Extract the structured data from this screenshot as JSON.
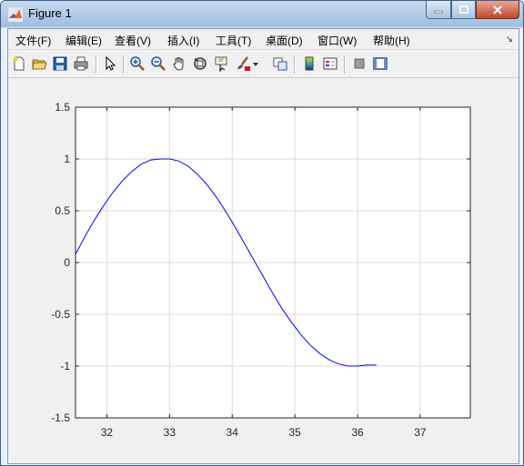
{
  "window": {
    "title": "Figure 1",
    "buttons": [
      "minimize",
      "maximize",
      "close"
    ]
  },
  "menu": {
    "items": [
      "文件(F)",
      "编辑(E)",
      "查看(V)",
      "插入(I)",
      "工具(T)",
      "桌面(D)",
      "窗口(W)",
      "帮助(H)"
    ]
  },
  "toolbar": {
    "buttons": [
      "new-figure",
      "open-file",
      "save",
      "print",
      "edit-plot",
      "zoom-in",
      "zoom-out",
      "pan",
      "rotate-3d",
      "data-cursor",
      "brush",
      "link-plot",
      "insert-colorbar",
      "insert-legend",
      "hide-plot-tools",
      "show-plot-tools"
    ]
  },
  "colors": {
    "line": "#0000ff",
    "grid": "#d9d9d9",
    "axes_bg": "#ffffff",
    "figure_bg": "#f0f0f0"
  },
  "chart_data": {
    "type": "line",
    "title": "",
    "xlabel": "",
    "ylabel": "",
    "xlim": [
      31.5,
      37.8
    ],
    "ylim": [
      -1.5,
      1.5
    ],
    "xticks": [
      32,
      33,
      34,
      35,
      36,
      37
    ],
    "yticks": [
      -1.5,
      -1,
      -0.5,
      0,
      0.5,
      1,
      1.5
    ],
    "xtick_labels": [
      "32",
      "33",
      "34",
      "35",
      "36",
      "37"
    ],
    "ytick_labels": [
      "-1.5",
      "-1",
      "-0.5",
      "0",
      "0.5",
      "1",
      "1.5"
    ],
    "grid": true,
    "series": [
      {
        "color": "#0000ff",
        "x": [
          31.5,
          31.65,
          31.8,
          31.95,
          32.1,
          32.25,
          32.4,
          32.55,
          32.7,
          32.85,
          33.0,
          33.15,
          33.3,
          33.45,
          33.6,
          33.75,
          33.9,
          34.05,
          34.2,
          34.35,
          34.5,
          34.65,
          34.8,
          34.95,
          35.1,
          35.25,
          35.4,
          35.55,
          35.7,
          35.85,
          36.0,
          36.15,
          36.3
        ],
        "y": [
          0.08,
          0.25,
          0.41,
          0.55,
          0.68,
          0.79,
          0.88,
          0.95,
          0.99,
          1.0,
          1.0,
          0.98,
          0.93,
          0.85,
          0.75,
          0.63,
          0.49,
          0.34,
          0.18,
          0.02,
          -0.14,
          -0.3,
          -0.45,
          -0.58,
          -0.7,
          -0.8,
          -0.88,
          -0.94,
          -0.98,
          -1.0,
          -1.0,
          -0.99,
          -0.99
        ]
      }
    ]
  }
}
